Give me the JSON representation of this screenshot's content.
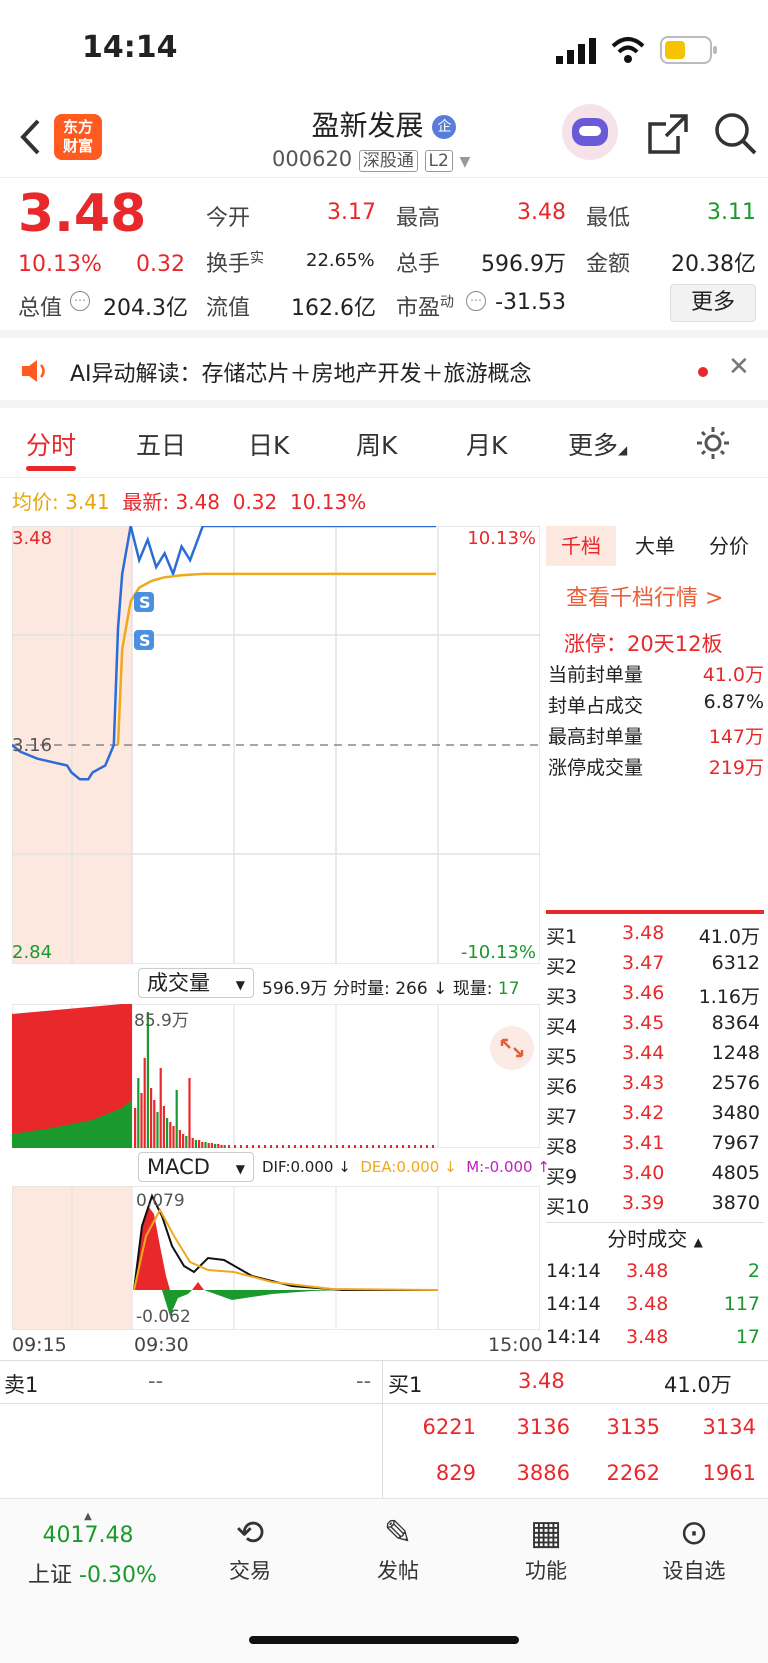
{
  "status": {
    "time": "14:14"
  },
  "header": {
    "logo_line1": "东方",
    "logo_line2": "财富",
    "title": "盈新发展",
    "title_badge": "企",
    "code": "000620",
    "tag_connect": "深股通",
    "tag_level": "L2"
  },
  "quote": {
    "price": "3.48",
    "change_pct": "10.13%",
    "change_amt": "0.32",
    "open_label": "今开",
    "open_value": "3.17",
    "high_label": "最高",
    "high_value": "3.48",
    "low_label": "最低",
    "low_value": "3.11",
    "turnover_label": "换手",
    "turnover_sup": "实",
    "turnover_value": "22.65%",
    "volume_label": "总手",
    "volume_value": "596.9万",
    "amount_label": "金额",
    "amount_value": "20.38亿",
    "mktcap_label": "总值",
    "mktcap_value": "204.3亿",
    "float_label": "流值",
    "float_value": "162.6亿",
    "pe_label": "市盈",
    "pe_sup": "动",
    "pe_value": "-31.53",
    "more_button": "更多"
  },
  "ai_bar": {
    "text": "AI异动解读：存储芯片＋房地产开发＋旅游概念"
  },
  "tabs": [
    "分时",
    "五日",
    "日K",
    "周K",
    "月K",
    "更多"
  ],
  "chart_header": {
    "avg_label": "均价:",
    "avg_value": "3.41",
    "latest_label": "最新:",
    "latest_value": "3.48",
    "latest_change": "0.32",
    "latest_pct": "10.13%"
  },
  "chart_data": [
    {
      "type": "line",
      "title": "分时",
      "x_labels": [
        "09:15",
        "09:30",
        "15:00"
      ],
      "y_left_top": "3.48",
      "y_left_mid": "3.16",
      "y_left_bottom": "2.84",
      "y_right_top": "10.13%",
      "y_right_bottom": "-10.13%",
      "ylim": [
        2.84,
        3.48
      ],
      "series": [
        {
          "name": "最新",
          "color": "#2b6cd6",
          "x": [
            0,
            0.02,
            0.06,
            0.13,
            0.14,
            0.16,
            0.18,
            0.19,
            0.22,
            0.24,
            0.25,
            0.26,
            0.28,
            0.3,
            0.32,
            0.34,
            0.36,
            0.38,
            0.4,
            0.42,
            0.45,
            0.5,
            0.6,
            0.7,
            0.8,
            0.9,
            1.0
          ],
          "values": [
            3.16,
            3.15,
            3.14,
            3.13,
            3.12,
            3.11,
            3.11,
            3.12,
            3.13,
            3.16,
            3.33,
            3.41,
            3.48,
            3.43,
            3.46,
            3.42,
            3.44,
            3.41,
            3.45,
            3.43,
            3.48,
            3.48,
            3.48,
            3.48,
            3.48,
            3.48,
            3.48
          ]
        },
        {
          "name": "均价",
          "color": "#f0a81c",
          "x": [
            0.25,
            0.26,
            0.28,
            0.3,
            0.33,
            0.36,
            0.4,
            0.45,
            0.55,
            0.7,
            1.0
          ],
          "values": [
            3.16,
            3.3,
            3.37,
            3.39,
            3.4,
            3.405,
            3.408,
            3.41,
            3.41,
            3.41,
            3.41
          ]
        }
      ]
    },
    {
      "type": "bar",
      "title": "成交量",
      "summary": "596.9万",
      "fenshi_label": "分时量:",
      "fenshi_value": "266 ↓",
      "now_label": "现量:",
      "now_value": "17",
      "peak_label": "85.9万"
    },
    {
      "type": "line",
      "title": "MACD",
      "dif_label": "DIF:0.000 ↓",
      "dea_label": "DEA:0.000 ↓",
      "m_label": "M:-0.000 ↑",
      "y_top": "0.079",
      "y_bottom": "-0.062"
    }
  ],
  "side_panel": {
    "tabs": [
      "千档",
      "大单",
      "分价"
    ],
    "link": "查看千档行情 >",
    "limit_title": "涨停：20天12板",
    "stats": [
      {
        "label": "当前封单量",
        "value": "41.0万"
      },
      {
        "label": "封单占成交",
        "value": "6.87%"
      },
      {
        "label": "最高封单量",
        "value": "147万"
      },
      {
        "label": "涨停成交量",
        "value": "219万"
      }
    ],
    "bids": [
      {
        "label": "买1",
        "price": "3.48",
        "vol": "41.0万"
      },
      {
        "label": "买2",
        "price": "3.47",
        "vol": "6312"
      },
      {
        "label": "买3",
        "price": "3.46",
        "vol": "1.16万"
      },
      {
        "label": "买4",
        "price": "3.45",
        "vol": "8364"
      },
      {
        "label": "买5",
        "price": "3.44",
        "vol": "1248"
      },
      {
        "label": "买6",
        "price": "3.43",
        "vol": "2576"
      },
      {
        "label": "买7",
        "price": "3.42",
        "vol": "3480"
      },
      {
        "label": "买8",
        "price": "3.41",
        "vol": "7967"
      },
      {
        "label": "买9",
        "price": "3.40",
        "vol": "4805"
      },
      {
        "label": "买10",
        "price": "3.39",
        "vol": "3870"
      }
    ],
    "trade_title": "分时成交",
    "trades": [
      {
        "time": "14:14",
        "price": "3.48",
        "vol": "2"
      },
      {
        "time": "14:14",
        "price": "3.48",
        "vol": "117"
      },
      {
        "time": "14:14",
        "price": "3.48",
        "vol": "17"
      }
    ]
  },
  "queue": {
    "sell_label": "卖1",
    "sell_price": "--",
    "sell_vol": "--",
    "buy_label": "买1",
    "buy_price": "3.48",
    "buy_vol": "41.0万",
    "row1": [
      "6221",
      "3136",
      "3135",
      "3134"
    ],
    "row2": [
      "829",
      "3886",
      "2262",
      "1961"
    ]
  },
  "bottom_nav": {
    "index_value": "4017.48",
    "index_name": "上证",
    "index_change": "-0.30%",
    "trade": "交易",
    "post": "发帖",
    "function": "功能",
    "watchlist": "设自选"
  }
}
